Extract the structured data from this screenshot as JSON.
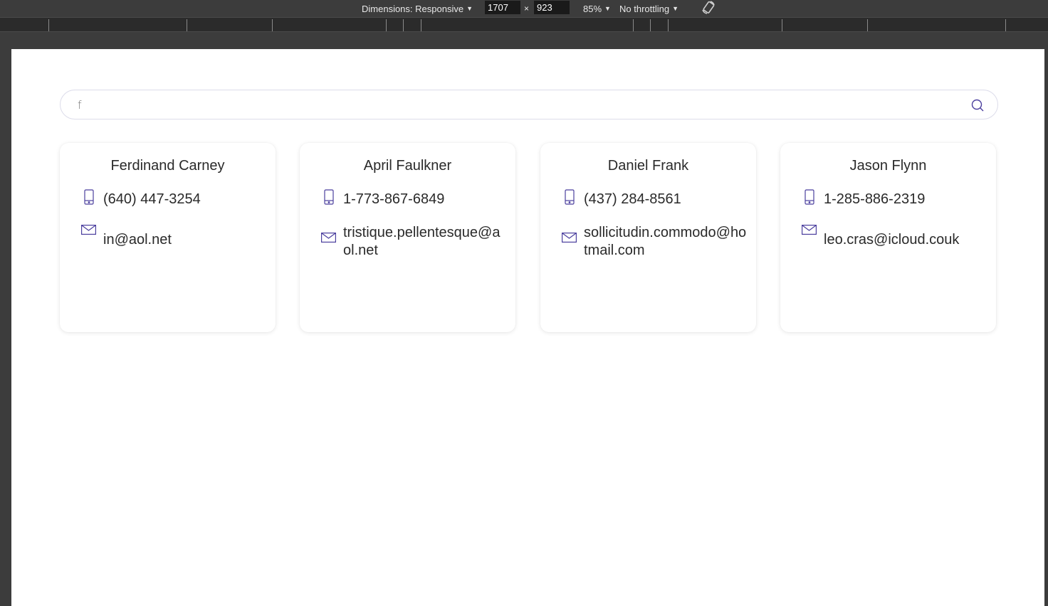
{
  "devtools": {
    "dimensions_label": "Dimensions: Responsive",
    "width_value": "1707",
    "times": "×",
    "height_value": "923",
    "zoom": "85%",
    "throttling": "No throttling",
    "rotate_icon": "rotate-icon"
  },
  "search": {
    "value": "f",
    "icon": "search-icon"
  },
  "contacts": [
    {
      "name": "Ferdinand Carney",
      "phone": "(640) 447-3254",
      "email": "in@aol.net"
    },
    {
      "name": "April Faulkner",
      "phone": "1-773-867-6849",
      "email": "tristique.pellentesque@aol.net"
    },
    {
      "name": "Daniel Frank",
      "phone": "(437) 284-8561",
      "email": "sollicitudin.commodo@hotmail.com"
    },
    {
      "name": "Jason Flynn",
      "phone": "1-285-886-2319",
      "email": "leo.cras@icloud.couk"
    }
  ],
  "colors": {
    "accent": "#4b3f9e",
    "devtools_bg": "#3c3c3c",
    "page_bg": "#ffffff"
  }
}
